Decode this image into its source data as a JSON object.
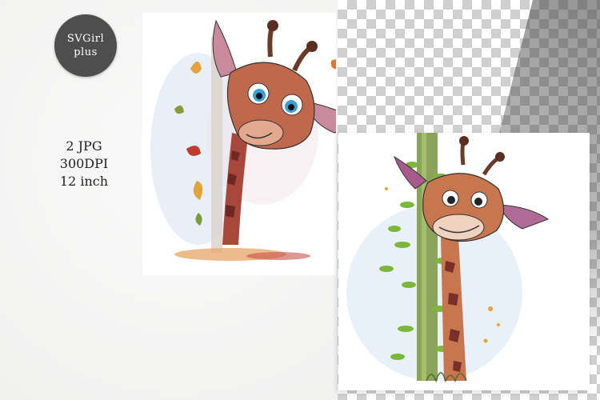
{
  "brand": {
    "line1": "SVGirl",
    "line2": "plus"
  },
  "specs": {
    "line1": "2 JPG",
    "line2": "300DPI",
    "line3": "12 inch"
  },
  "colors": {
    "giraffe_body": "#b8654a",
    "giraffe_spots": "#7a2f2a",
    "eye_blue": "#3aa0d8",
    "leaf_green": "#7bb83a",
    "badge_bg": "#4e4e4e"
  },
  "images": [
    {
      "name": "giraffe-peeking-from-tree",
      "leaves": "autumn-leaves"
    },
    {
      "name": "giraffe-behind-vine-post",
      "leaves": "green-vines"
    }
  ]
}
